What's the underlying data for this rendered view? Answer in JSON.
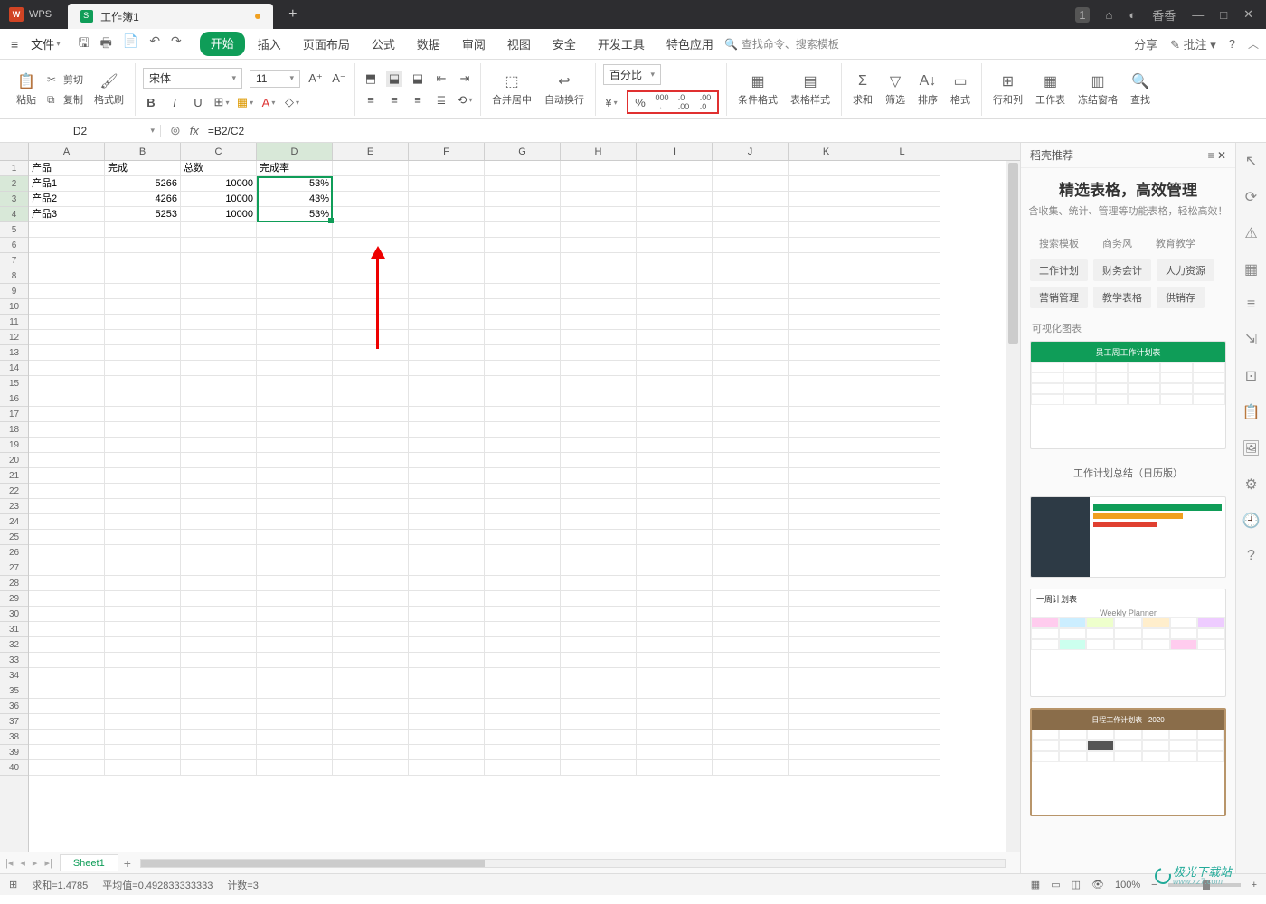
{
  "app": {
    "name": "WPS",
    "doc_tab": "工作簿1",
    "user": "香香"
  },
  "menu": {
    "file": "文件",
    "tabs": [
      "开始",
      "插入",
      "页面布局",
      "公式",
      "数据",
      "审阅",
      "视图",
      "安全",
      "开发工具",
      "特色应用"
    ],
    "search_placeholder": "查找命令、搜索模板",
    "share": "分享",
    "annotate": "批注"
  },
  "ribbon": {
    "paste": "粘贴",
    "cut": "剪切",
    "copy": "复制",
    "format_painter": "格式刷",
    "font_name": "宋体",
    "font_size": "11",
    "merge_center": "合并居中",
    "wrap": "自动换行",
    "number_format": "百分比",
    "cond_fmt": "条件格式",
    "table_style": "表格样式",
    "sum": "求和",
    "filter": "筛选",
    "sort": "排序",
    "format": "格式",
    "rows_cols": "行和列",
    "worksheet": "工作表",
    "freeze": "冻结窗格",
    "find": "查找"
  },
  "cellref": {
    "name": "D2",
    "formula": "=B2/C2"
  },
  "columns": [
    "A",
    "B",
    "C",
    "D",
    "E",
    "F",
    "G",
    "H",
    "I",
    "J",
    "K",
    "L"
  ],
  "headers": {
    "A": "产品",
    "B": "完成",
    "C": "总数",
    "D": "完成率"
  },
  "rows": [
    {
      "A": "产品1",
      "B": "5266",
      "C": "10000",
      "D": "53%"
    },
    {
      "A": "产品2",
      "B": "4266",
      "C": "10000",
      "D": "43%"
    },
    {
      "A": "产品3",
      "B": "5253",
      "C": "10000",
      "D": "53%"
    }
  ],
  "sheet": {
    "name": "Sheet1"
  },
  "status": {
    "sum": "求和=1.4785",
    "avg": "平均值=0.492833333333",
    "count": "计数=3",
    "zoom": "100%"
  },
  "panel": {
    "header": "稻壳推荐",
    "title": "精选表格，高效管理",
    "subtitle": "含收集、统计、管理等功能表格，轻松高效！",
    "tags_row1": [
      "搜索模板",
      "商务风",
      "教育教学"
    ],
    "tags_row2": [
      "工作计划",
      "财务会计",
      "人力资源"
    ],
    "tags_row3": [
      "营销管理",
      "教学表格",
      "供销存"
    ],
    "section": "可视化图表",
    "tmpl1_hdr": "员工周工作计划表",
    "tmpl2_label": "工作计划总结（日历版）",
    "tmpl3_hdr": "一周计划表",
    "tmpl3_sub": "Weekly Planner"
  },
  "watermark": "极光下载站",
  "watermark_url": "www.xz7.com"
}
